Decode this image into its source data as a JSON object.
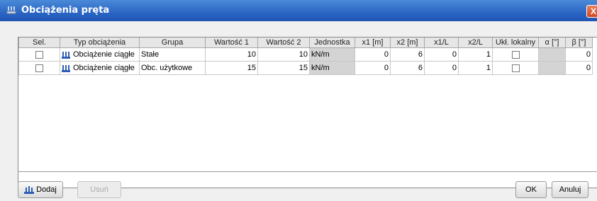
{
  "window": {
    "title": "Obciążenia pręta",
    "close_glyph": "X"
  },
  "table": {
    "columns": [
      "Sel.",
      "Typ obciążenia",
      "Grupa",
      "Wartość 1",
      "Wartość 2",
      "Jednostka",
      "x1 [m]",
      "x2 [m]",
      "x1/L",
      "x2/L",
      "Ukł. lokalny",
      "α [°]",
      "β [°]"
    ],
    "rows": [
      {
        "type": "Obciążenie ciągłe",
        "group": "Stałe",
        "value1": "10",
        "value2": "10",
        "unit": "kN/m",
        "x1": "0",
        "x2": "6",
        "x1L": "0",
        "x2L": "1",
        "beta": "0"
      },
      {
        "type": "Obciążenie ciągłe",
        "group": "Obc. użytkowe",
        "value1": "15",
        "value2": "15",
        "unit": "kN/m",
        "x1": "0",
        "x2": "6",
        "x1L": "0",
        "x2L": "1",
        "beta": "0"
      }
    ]
  },
  "buttons": {
    "add": "Dodaj",
    "remove": "Usuń",
    "ok": "OK",
    "cancel": "Anuluj"
  },
  "icons": {
    "title": "beam-load-icon",
    "row": "distributed-load-icon",
    "add": "add-load-icon"
  },
  "colors": {
    "titlebar": "#2b66c4",
    "close": "#d2451f",
    "icon_blue": "#2f5fb4"
  }
}
